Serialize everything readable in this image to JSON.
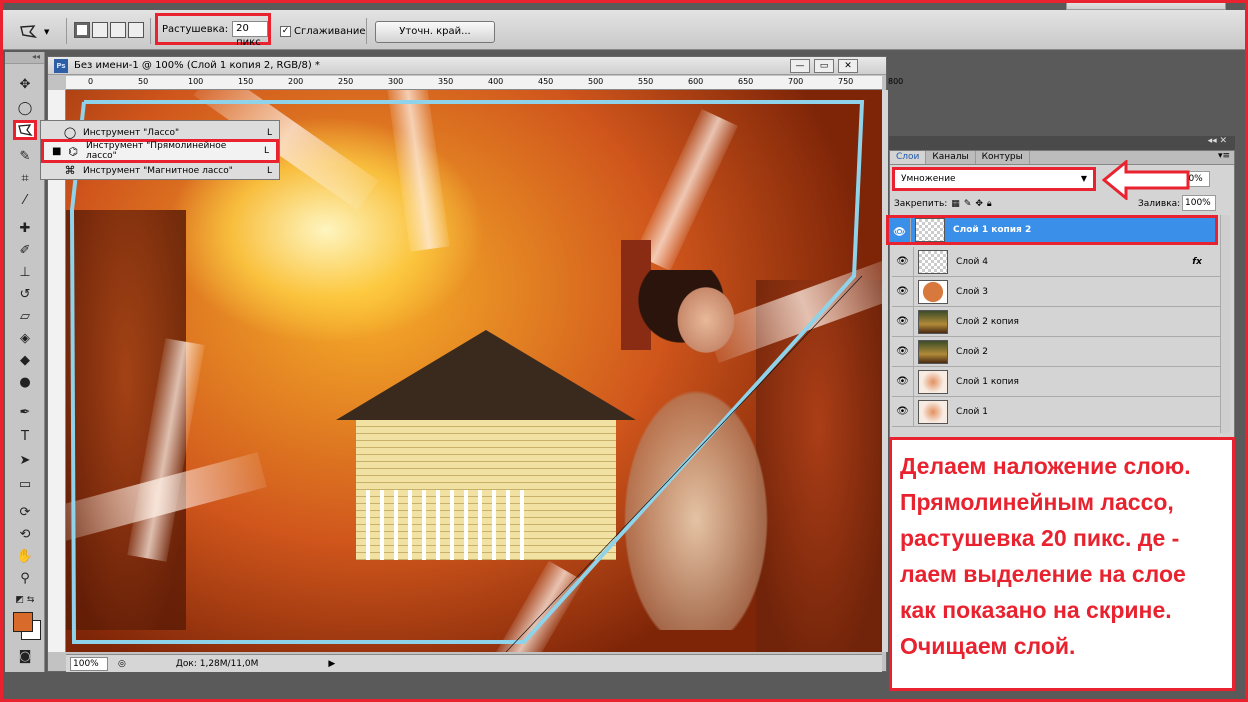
{
  "options_bar": {
    "feather_label": "Растушевка:",
    "feather_value": "20 пикс",
    "antialias_label": "Сглаживание",
    "refine_edge_label": "Уточн. край..."
  },
  "flyout": {
    "items": [
      {
        "name": "Инструмент \"Лассо\"",
        "key": "L"
      },
      {
        "name": "Инструмент \"Прямолинейное лассо\"",
        "key": "L"
      },
      {
        "name": "Инструмент \"Магнитное лассо\"",
        "key": "L"
      }
    ]
  },
  "document": {
    "title": "Без имени-1 @ 100% (Слой 1 копия 2, RGB/8) *",
    "ruler_ticks": [
      "0",
      "50",
      "100",
      "150",
      "200",
      "250",
      "300",
      "350",
      "400",
      "450",
      "500",
      "550",
      "600",
      "650",
      "700",
      "750",
      "800"
    ],
    "zoom": "100%",
    "doc_info": "Док: 1,28М/11,0М"
  },
  "layers_panel": {
    "tabs": [
      "Слои",
      "Каналы",
      "Контуры"
    ],
    "blend_mode": "Умножение",
    "opacity": "100%",
    "lock_label": "Закрепить:",
    "fill_label": "Заливка:",
    "fill_value": "100%",
    "layers": [
      {
        "name": "Слой 1 копия 2",
        "thumb": "checker",
        "active": true
      },
      {
        "name": "Слой 4",
        "thumb": "checker",
        "fx": "fx"
      },
      {
        "name": "Слой 3",
        "thumb": "orange"
      },
      {
        "name": "Слой 2 копия",
        "thumb": "photo"
      },
      {
        "name": "Слой 2",
        "thumb": "photo"
      },
      {
        "name": "Слой 1 копия",
        "thumb": "pattern"
      },
      {
        "name": "Слой 1",
        "thumb": "pattern"
      }
    ]
  },
  "note": {
    "text": "Делаем наложение слою. Прямолинейным лассо, растушевка 20 пикс. де - лаем выделение на слое как показано на скрине. Очищаем слой."
  },
  "colors": {
    "highlight": "#e8222e",
    "foreground_swatch": "#d86a2c",
    "active_layer": "#3a8fe8"
  }
}
